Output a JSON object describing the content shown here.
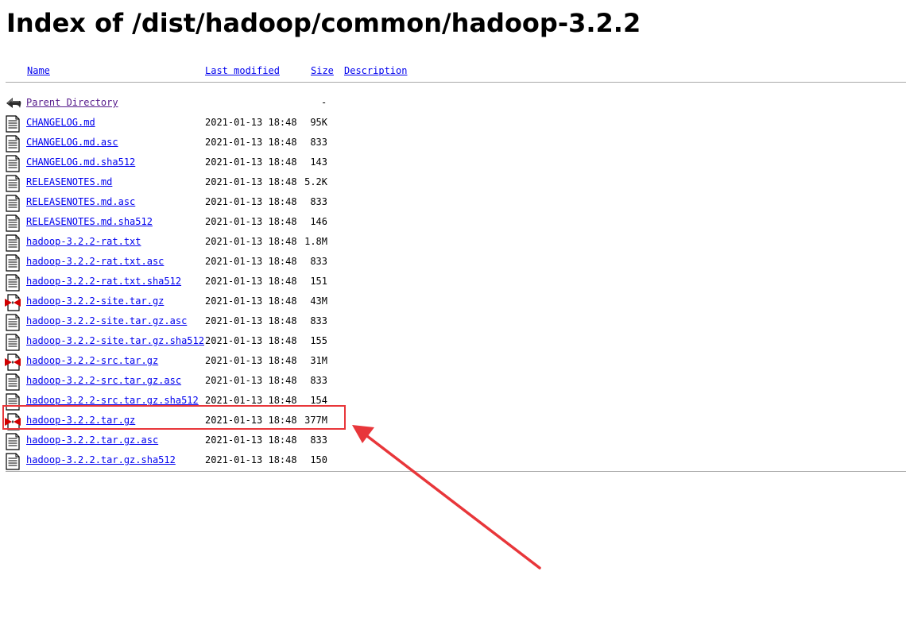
{
  "title": "Index of /dist/hadoop/common/hadoop-3.2.2",
  "columns": {
    "name": "Name",
    "last_modified": "Last modified",
    "size": "Size",
    "description": "Description"
  },
  "parent": {
    "label": "Parent Directory",
    "size": "-"
  },
  "files": [
    {
      "name": "CHANGELOG.md",
      "date": "2021-01-13 18:48",
      "size": "95K",
      "icon": "text-icon"
    },
    {
      "name": "CHANGELOG.md.asc",
      "date": "2021-01-13 18:48",
      "size": "833",
      "icon": "text-icon"
    },
    {
      "name": "CHANGELOG.md.sha512",
      "date": "2021-01-13 18:48",
      "size": "143",
      "icon": "text-icon"
    },
    {
      "name": "RELEASENOTES.md",
      "date": "2021-01-13 18:48",
      "size": "5.2K",
      "icon": "text-icon"
    },
    {
      "name": "RELEASENOTES.md.asc",
      "date": "2021-01-13 18:48",
      "size": "833",
      "icon": "text-icon"
    },
    {
      "name": "RELEASENOTES.md.sha512",
      "date": "2021-01-13 18:48",
      "size": "146",
      "icon": "text-icon"
    },
    {
      "name": "hadoop-3.2.2-rat.txt",
      "date": "2021-01-13 18:48",
      "size": "1.8M",
      "icon": "text-icon"
    },
    {
      "name": "hadoop-3.2.2-rat.txt.asc",
      "date": "2021-01-13 18:48",
      "size": "833",
      "icon": "text-icon"
    },
    {
      "name": "hadoop-3.2.2-rat.txt.sha512",
      "date": "2021-01-13 18:48",
      "size": "151",
      "icon": "text-icon"
    },
    {
      "name": "hadoop-3.2.2-site.tar.gz",
      "date": "2021-01-13 18:48",
      "size": "43M",
      "icon": "compressed-icon"
    },
    {
      "name": "hadoop-3.2.2-site.tar.gz.asc",
      "date": "2021-01-13 18:48",
      "size": "833",
      "icon": "text-icon"
    },
    {
      "name": "hadoop-3.2.2-site.tar.gz.sha512",
      "date": "2021-01-13 18:48",
      "size": "155",
      "icon": "text-icon"
    },
    {
      "name": "hadoop-3.2.2-src.tar.gz",
      "date": "2021-01-13 18:48",
      "size": "31M",
      "icon": "compressed-icon"
    },
    {
      "name": "hadoop-3.2.2-src.tar.gz.asc",
      "date": "2021-01-13 18:48",
      "size": "833",
      "icon": "text-icon"
    },
    {
      "name": "hadoop-3.2.2-src.tar.gz.sha512",
      "date": "2021-01-13 18:48",
      "size": "154",
      "icon": "text-icon"
    },
    {
      "name": "hadoop-3.2.2.tar.gz",
      "date": "2021-01-13 18:48",
      "size": "377M",
      "icon": "compressed-icon"
    },
    {
      "name": "hadoop-3.2.2.tar.gz.asc",
      "date": "2021-01-13 18:48",
      "size": "833",
      "icon": "text-icon"
    },
    {
      "name": "hadoop-3.2.2.tar.gz.sha512",
      "date": "2021-01-13 18:48",
      "size": "150",
      "icon": "text-icon"
    }
  ],
  "colors": {
    "link": "#0000ee",
    "visited": "#551a8b",
    "annotation": "#e8363a"
  },
  "annotation": {
    "highlighted_file": "hadoop-3.2.2.tar.gz"
  }
}
